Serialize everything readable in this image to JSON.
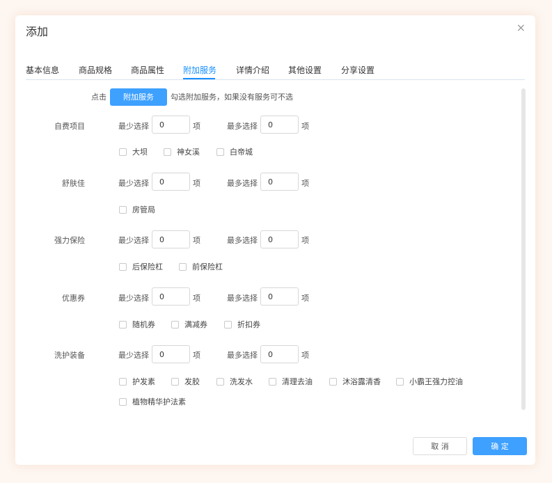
{
  "dialog": {
    "title": "添加",
    "close_glyph": "×"
  },
  "tabs": [
    {
      "label": "基本信息"
    },
    {
      "label": "商品规格"
    },
    {
      "label": "商品属性"
    },
    {
      "label": "附加服务",
      "active": true
    },
    {
      "label": "详情介绍"
    },
    {
      "label": "其他设置"
    },
    {
      "label": "分享设置"
    }
  ],
  "hint": {
    "prefix": "点击",
    "button": "附加服务",
    "suffix": "勾选附加服务，如果没有服务可不选"
  },
  "min_label": "最少选择",
  "max_label": "最多选择",
  "unit": "项",
  "groups": [
    {
      "name": "自费项目",
      "min": "0",
      "max": "0",
      "options": [
        "大坝",
        "神女溪",
        "白帝城"
      ]
    },
    {
      "name": "舒肤佳",
      "min": "0",
      "max": "0",
      "options": [
        "房管局"
      ]
    },
    {
      "name": "强力保险",
      "min": "0",
      "max": "0",
      "options": [
        "后保险杠",
        "前保险杠"
      ]
    },
    {
      "name": "优惠券",
      "min": "0",
      "max": "0",
      "options": [
        "随机券",
        "满减券",
        "折扣券"
      ]
    },
    {
      "name": "洗护装备",
      "min": "0",
      "max": "0",
      "options": [
        "护发素",
        "发胶",
        "洗发水",
        "清理去油",
        "沐浴露清香",
        "小霸王强力控油",
        "植物精华护法素"
      ]
    }
  ],
  "footer": {
    "cancel": "取 消",
    "confirm": "确 定"
  },
  "colors": {
    "accent": "#3ea0ff",
    "tab_active": "#1890ff"
  }
}
